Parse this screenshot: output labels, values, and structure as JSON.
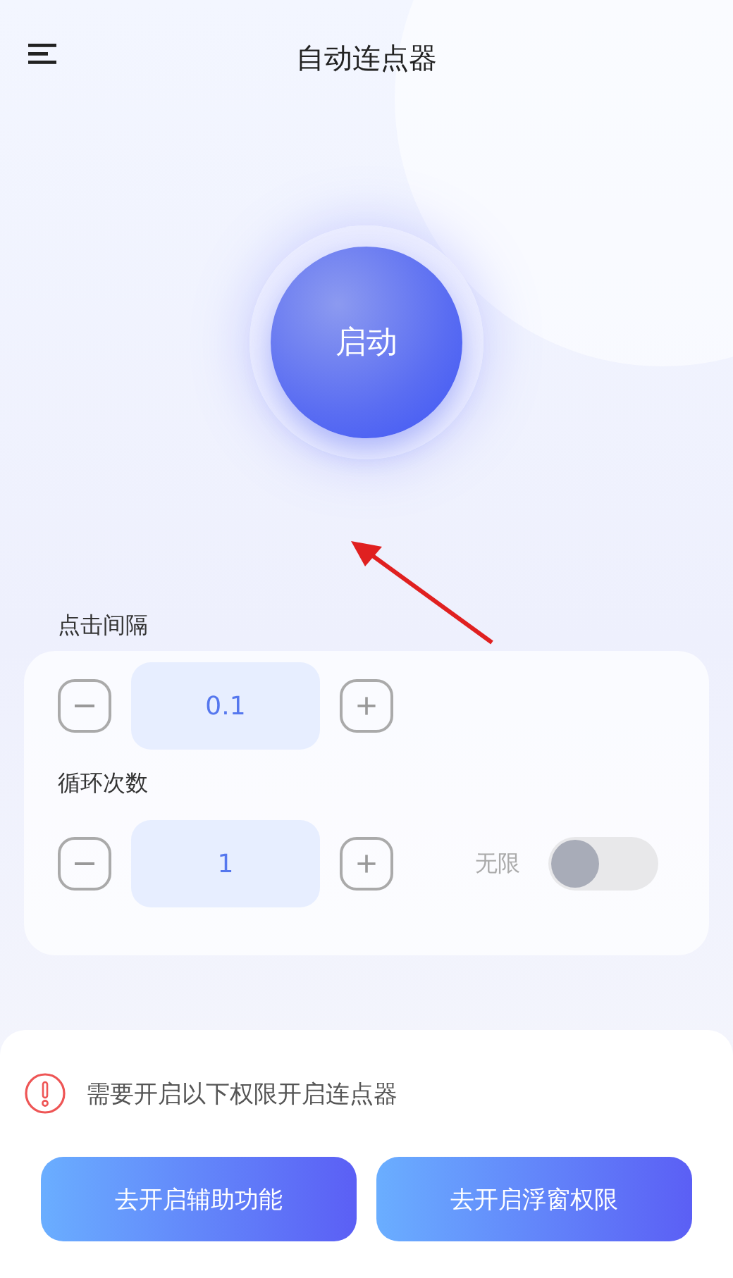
{
  "header": {
    "title": "自动连点器"
  },
  "start_button": {
    "label": "启动"
  },
  "settings": [
    {
      "label": "点击间隔",
      "value": "0.1",
      "kind": "stepper"
    },
    {
      "label": "循环次数",
      "value": "1",
      "kind": "stepper_toggle",
      "toggle_label": "无限",
      "on": false
    }
  ],
  "notice": {
    "text": "需要开启以下权限开启连点器"
  },
  "buttons": [
    "去开启辅助功能",
    "去开启浮窗权限"
  ]
}
